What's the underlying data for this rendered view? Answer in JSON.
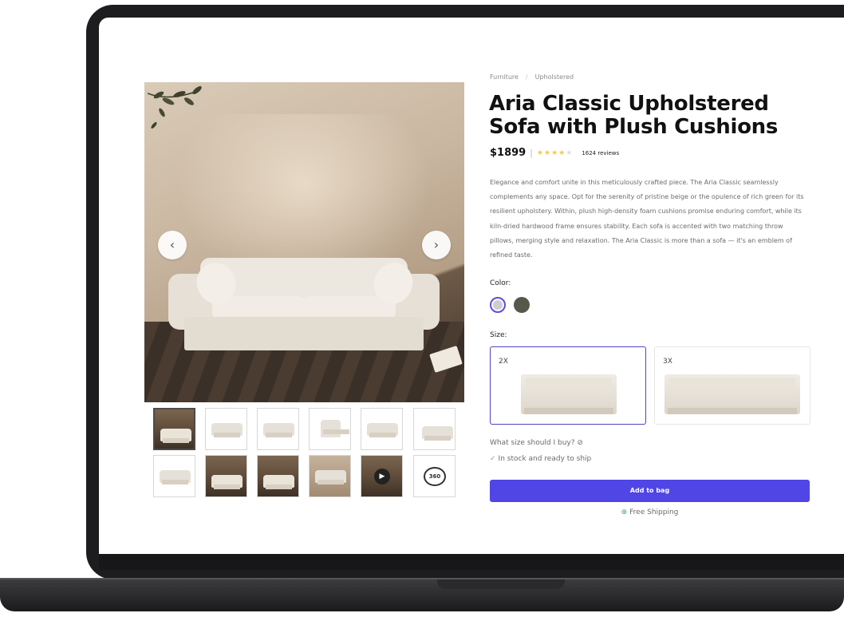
{
  "breadcrumb": {
    "items": [
      "Furniture",
      "Upholstered"
    ],
    "separator": "/"
  },
  "product": {
    "title": "Aria Classic Upholstered Sofa with Plush Cushions",
    "price": "$1899",
    "price_separator": "|",
    "rating": 4,
    "stars": "★★★★",
    "stars_off": "★",
    "reviews": "1624 reviews",
    "description": "Elegance and comfort unite in this meticulously crafted piece. The Aria Classic seamlessly complements any space. Opt for the serenity of pristine beige or the opulence of rich green for its resilient upholstery. Within, plush high-density foam cushions promise enduring comfort, while its kiln-dried hardwood frame ensures stability. Each sofa is accented with two matching throw pillows, merging style and relaxation. The Aria Classic is more than a sofa — it's an emblem of refined taste."
  },
  "gallery": {
    "prev_icon": "‹",
    "next_icon": "›",
    "thumbnails_count": 12,
    "selected_thumbnail": 1,
    "badge_360": "360"
  },
  "color": {
    "label": "Color:",
    "options": [
      {
        "name": "beige",
        "hex": "#cfcdd0",
        "selected": true
      },
      {
        "name": "green",
        "hex": "#56584a",
        "selected": false
      }
    ]
  },
  "size": {
    "label": "Size:",
    "options": [
      {
        "name": "2X",
        "selected": true
      },
      {
        "name": "3X",
        "selected": false
      }
    ]
  },
  "size_help": {
    "text": "What size should I buy?",
    "icon": "⊘"
  },
  "stock": {
    "check_icon": "✓",
    "text": "In stock and ready to ship"
  },
  "cart": {
    "add_label": "Add to bag"
  },
  "shipping": {
    "icon": "⊛",
    "text": "Free Shipping"
  },
  "colors": {
    "accent": "#5045e5",
    "star": "#f2c94c"
  }
}
